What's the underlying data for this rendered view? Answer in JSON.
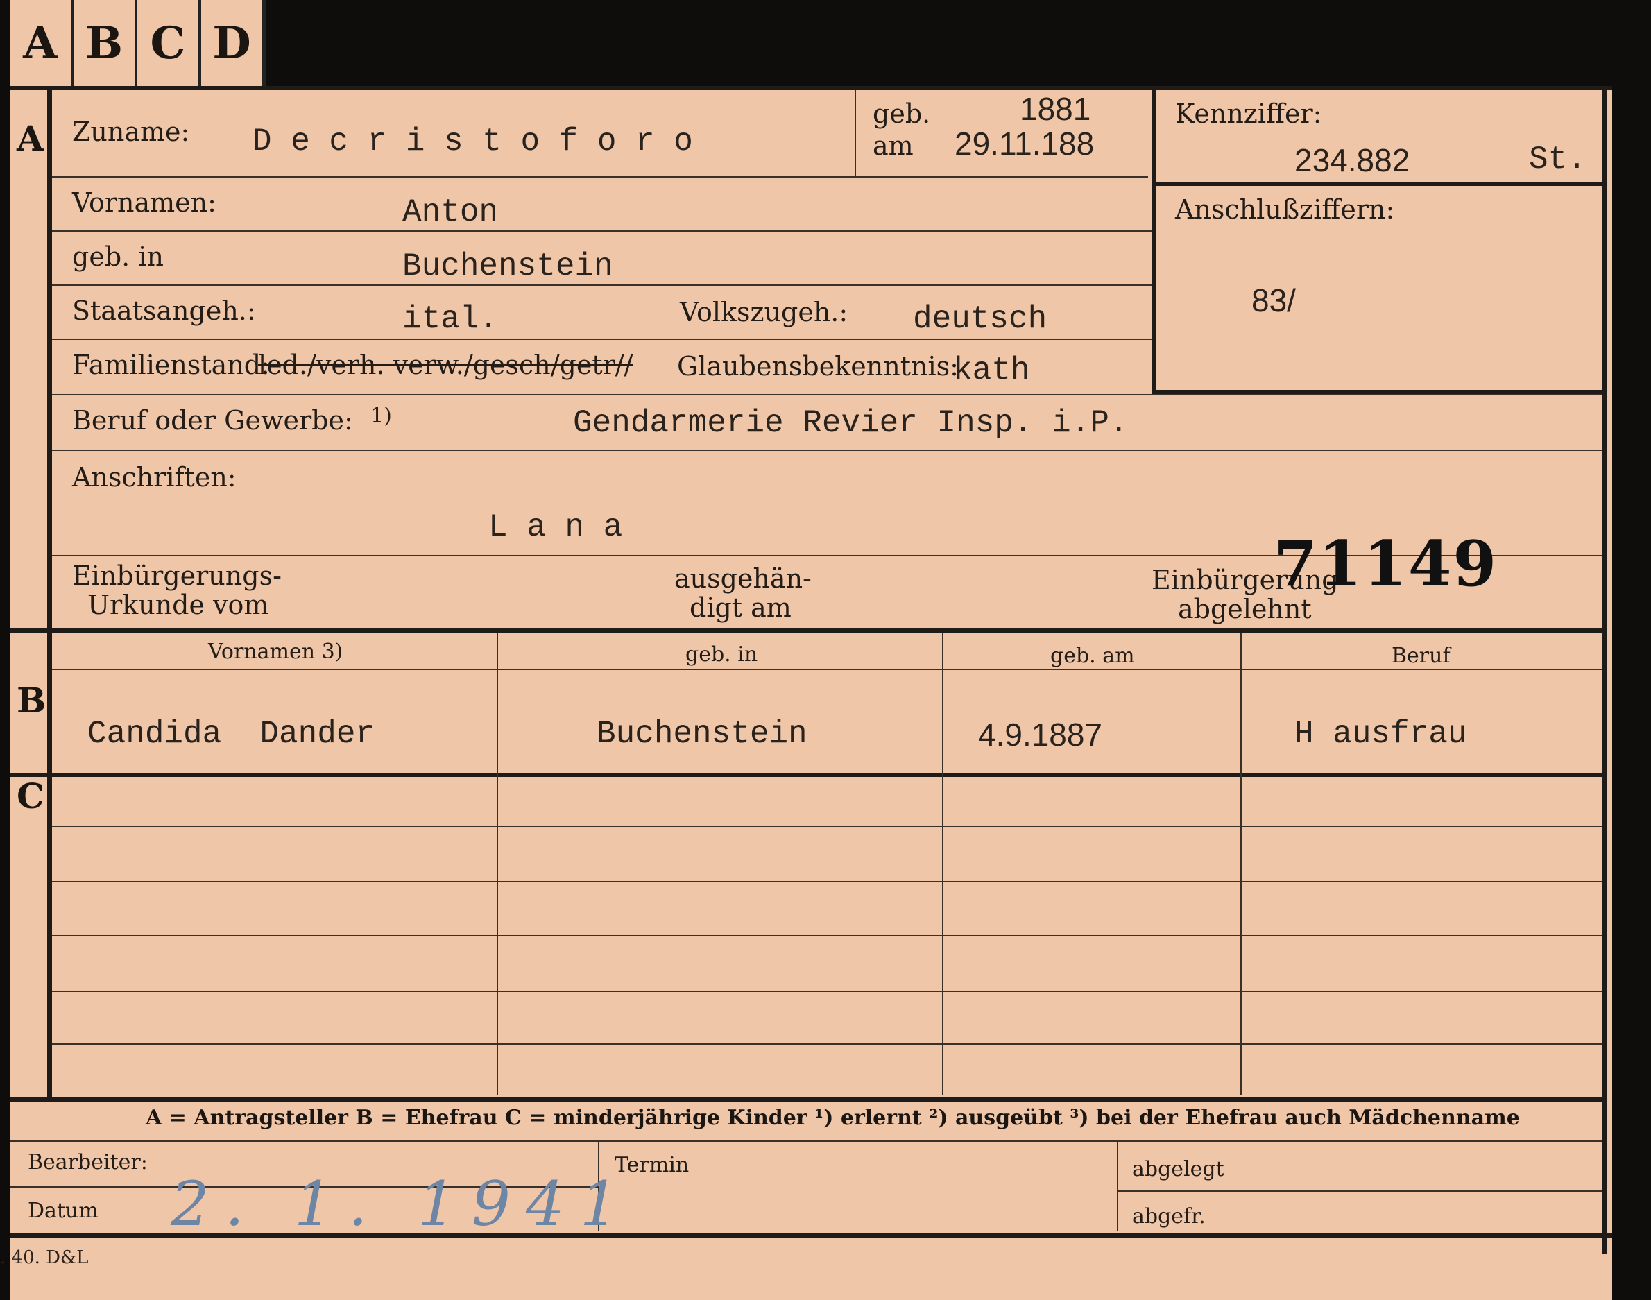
{
  "tabs": [
    "A",
    "B",
    "C",
    "D"
  ],
  "section_a": {
    "marker": "A",
    "surname_label": "Zuname:",
    "surname_value": "D e c r i s t o f o r o",
    "born_label": "geb.",
    "born_label2": "am",
    "born_year": "1881",
    "born_date": "29.11.188",
    "kennziffer_label": "Kennziffer:",
    "kennziffer_value": "234.882",
    "kennziffer_suffix": "St.",
    "anschluss_label": "Anschlußziffern:",
    "anschluss_value": "83/",
    "vornamen_label": "Vornamen:",
    "vornamen_value": "Anton",
    "geb_in_label": "geb. in",
    "geb_in_value": "Buchenstein",
    "staatsangeh_label": "Staatsangeh.:",
    "staatsangeh_value": "ital.",
    "volkszugeh_label": "Volkszugeh.:",
    "volkszugeh_value": "deutsch",
    "familienstand_label": "Familienstand:",
    "familienstand_options": "led./verh. verw./gesch/getr//",
    "glaubens_label": "Glaubensbekenntnis:",
    "glaubens_value": "kath",
    "beruf_label": "Beruf oder Gewerbe:",
    "beruf_note": "1)",
    "beruf_value": "Gendarmerie Revier Insp. i.P.",
    "anschriften_label": "Anschriften:",
    "anschriften_value": "L a n a",
    "einb_urkunde_label_1": "Einbürgerungs-",
    "einb_urkunde_label_2": "Urkunde vom",
    "ausgehaendigt_label_1": "ausgehän-",
    "ausgehaendigt_label_2": "digt am",
    "einb_abgelehnt_label_1": "Einbürgerung",
    "einb_abgelehnt_label_2": "abgelehnt",
    "stamp_number": "71149"
  },
  "section_b": {
    "marker": "B",
    "headers": [
      "Vornamen 3)",
      "geb. in",
      "geb. am",
      "Beruf"
    ],
    "row": [
      "Candida  Dander",
      "Buchenstein",
      "4.9.1887",
      "H ausfrau"
    ]
  },
  "section_c": {
    "marker": "C"
  },
  "legend": "A = Antragsteller   B = Ehefrau   C = minderjährige Kinder   ¹) erlernt   ²) ausgeübt   ³) bei der Ehefrau auch Mädchenname",
  "footer": {
    "bearbeiter_label": "Bearbeiter:",
    "datum_label": "Datum",
    "datum_value": "2. 1. 1941",
    "termin_label": "Termin",
    "abgelegt_label": "abgelegt",
    "abgefr_label": "abgefr."
  },
  "print_mark": ". 40. D&L"
}
